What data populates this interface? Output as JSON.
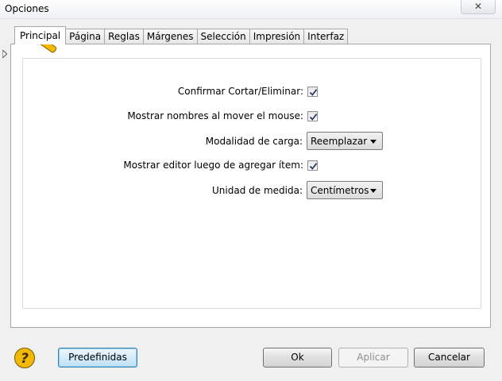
{
  "window": {
    "title": "Opciones",
    "close_symbol": "✕"
  },
  "tabs": [
    {
      "label": "Principal",
      "active": true
    },
    {
      "label": "Página"
    },
    {
      "label": "Reglas"
    },
    {
      "label": "Márgenes"
    },
    {
      "label": "Selección"
    },
    {
      "label": "Impresión"
    },
    {
      "label": "Interfaz"
    }
  ],
  "panel": {
    "icon": "wrench-icon",
    "confirm_cut": {
      "label": "Confirmar Cortar/Eliminar:",
      "checked": true
    },
    "show_names": {
      "label": "Mostrar nombres al mover el mouse:",
      "checked": true
    },
    "load_mode": {
      "label": "Modalidad de carga:",
      "value": "Reemplazar"
    },
    "show_editor": {
      "label": "Mostrar editor luego de agregar ítem:",
      "checked": true
    },
    "unit": {
      "label": "Unidad de medida:",
      "value": "Centímetros"
    }
  },
  "buttons": {
    "defaults": "Predefinidas",
    "ok": "Ok",
    "apply": "Aplicar",
    "cancel": "Cancelar"
  },
  "colors": {
    "accent": "#3c7fb1",
    "wrench": "#f5b800",
    "help": "#f2b807"
  }
}
